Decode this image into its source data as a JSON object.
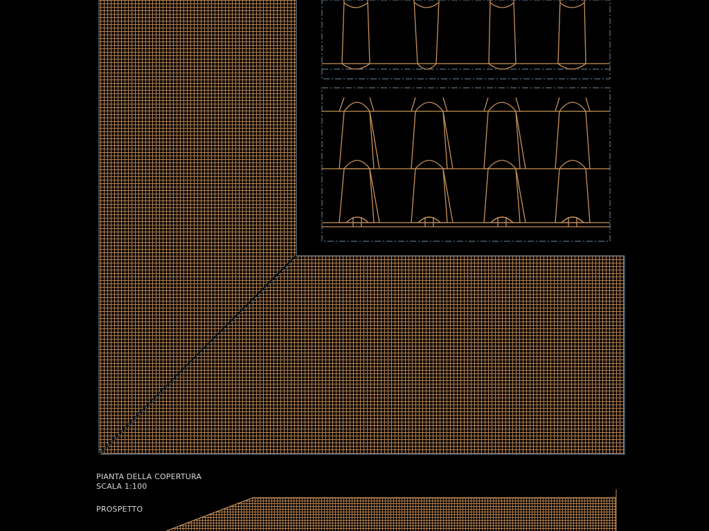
{
  "drawing": {
    "plan_title": "PIANTA DELLA COPERTURA",
    "plan_scale": "SCALA 1:100",
    "elevation_title": "PROSPETTO"
  },
  "colors": {
    "background": "#000000",
    "tile_line": "#c8925a",
    "tile_dense": "#a8784a",
    "outline": "#6e8ea3",
    "label": "#d8d8d8"
  }
}
